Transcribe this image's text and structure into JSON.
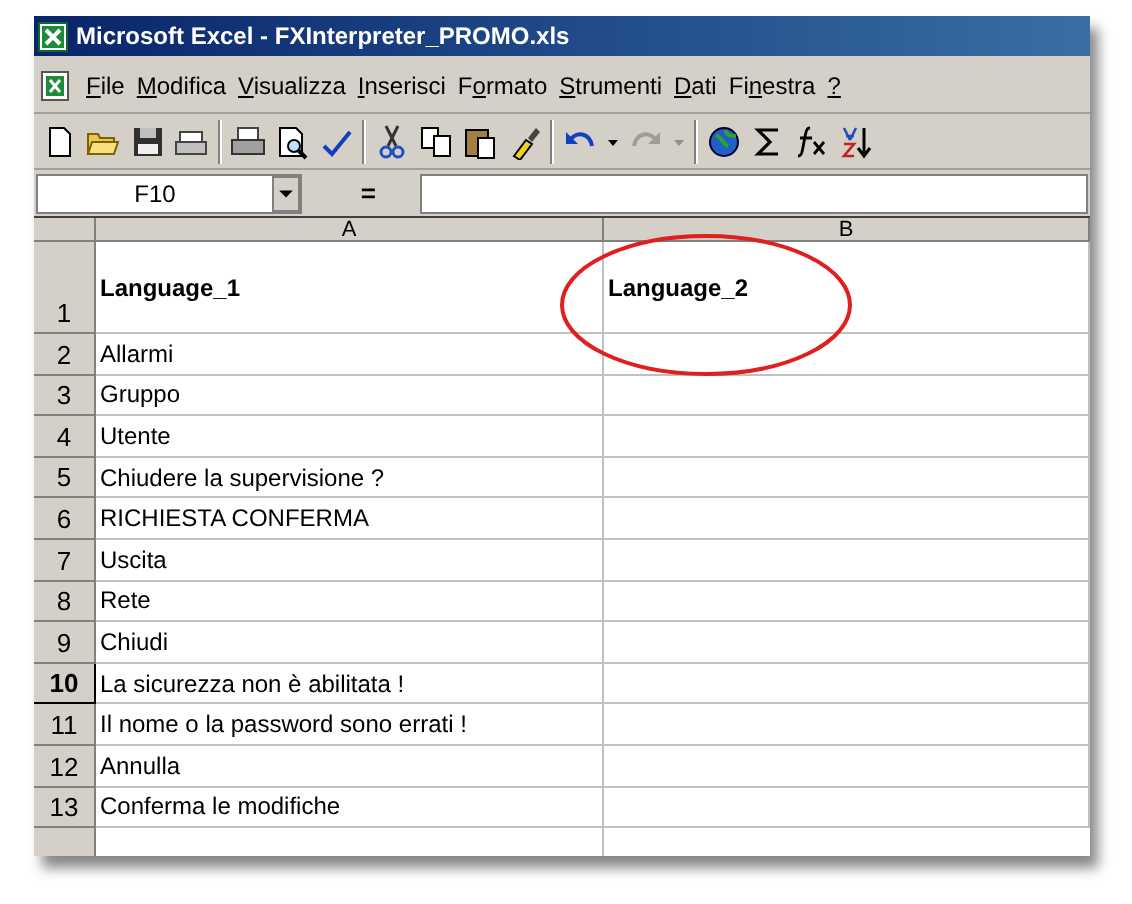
{
  "window": {
    "title": "Microsoft Excel - FXInterpreter_PROMO.xls"
  },
  "menu": [
    {
      "key": "F",
      "post": "ile"
    },
    {
      "key": "M",
      "post": "odifica"
    },
    {
      "key": "V",
      "post": "isualizza"
    },
    {
      "key": "I",
      "post": "nserisci"
    },
    {
      "pre": "F",
      "key": "o",
      "post": "rmato"
    },
    {
      "key": "S",
      "post": "trumenti"
    },
    {
      "key": "D",
      "post": "ati"
    },
    {
      "pre": "Fi",
      "key": "n",
      "post": "estra"
    },
    {
      "key": "?"
    }
  ],
  "toolbar": [
    {
      "kind": "new",
      "disabled": false
    },
    {
      "kind": "open",
      "disabled": false
    },
    {
      "kind": "save",
      "disabled": false
    },
    {
      "kind": "mail",
      "disabled": false
    },
    {
      "kind": "sep"
    },
    {
      "kind": "print",
      "disabled": false
    },
    {
      "kind": "preview",
      "disabled": false
    },
    {
      "kind": "spell",
      "disabled": false
    },
    {
      "kind": "sep"
    },
    {
      "kind": "cut",
      "disabled": false
    },
    {
      "kind": "copy",
      "disabled": false
    },
    {
      "kind": "paste",
      "disabled": false
    },
    {
      "kind": "brush",
      "disabled": false
    },
    {
      "kind": "sep"
    },
    {
      "kind": "undo",
      "disabled": false
    },
    {
      "kind": "drop",
      "disabled": false
    },
    {
      "kind": "redo",
      "disabled": true
    },
    {
      "kind": "drop",
      "disabled": true
    },
    {
      "kind": "sep"
    },
    {
      "kind": "globe",
      "disabled": false
    },
    {
      "kind": "sigma",
      "disabled": false
    },
    {
      "kind": "fx",
      "disabled": false
    },
    {
      "kind": "sort",
      "disabled": false
    }
  ],
  "formula_bar": {
    "name_box": "F10",
    "equals": "="
  },
  "columns": [
    "A",
    "B"
  ],
  "rows": [
    {
      "number": "1",
      "kind": "header",
      "selected": false,
      "a": "Language_1",
      "b": "Language_2"
    },
    {
      "number": "2",
      "kind": "plain",
      "selected": false,
      "a": "Allarmi"
    },
    {
      "number": "3",
      "kind": "plain",
      "selected": false,
      "a": "Gruppo"
    },
    {
      "number": "4",
      "kind": "plain",
      "selected": false,
      "a": "Utente"
    },
    {
      "number": "5",
      "kind": "plain",
      "selected": false,
      "a": "Chiudere la supervisione ?"
    },
    {
      "number": "6",
      "kind": "plain",
      "selected": false,
      "a": "RICHIESTA CONFERMA"
    },
    {
      "number": "7",
      "kind": "plain",
      "selected": false,
      "a": "Uscita"
    },
    {
      "number": "8",
      "kind": "plain",
      "selected": false,
      "a": "Rete"
    },
    {
      "number": "9",
      "kind": "plain",
      "selected": false,
      "a": "Chiudi"
    },
    {
      "number": "10",
      "kind": "plain",
      "selected": true,
      "a": "La sicurezza non è abilitata !"
    },
    {
      "number": "11",
      "kind": "plain",
      "selected": false,
      "a": "Il nome o la password sono errati !"
    },
    {
      "number": "12",
      "kind": "plain",
      "selected": false,
      "a": "Annulla"
    },
    {
      "number": "13",
      "kind": "plain",
      "selected": false,
      "a": "Conferma le modifiche"
    }
  ]
}
